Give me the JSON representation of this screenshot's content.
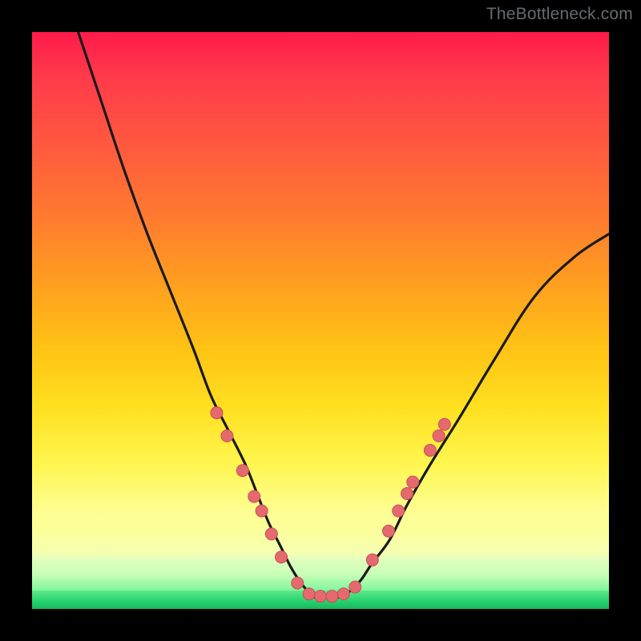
{
  "watermark": "TheBottleneck.com",
  "colors": {
    "frame": "#000000",
    "curve_stroke": "#1a1a1a",
    "dot_fill": "#e46a6f",
    "dot_stroke": "#c94f55",
    "gradient_top": "#ff1a4a",
    "gradient_bottom": "#16b85d"
  },
  "chart_data": {
    "type": "line",
    "title": "",
    "xlabel": "",
    "ylabel": "",
    "xlim": [
      0,
      100
    ],
    "ylim": [
      0,
      100
    ],
    "grid": false,
    "legend": false,
    "note": "Background is a vertical color gradient from red (top, high) through orange/yellow to green (bottom, low). The black curve is a V-shaped bottleneck profile with its minimum near x≈47–55 at y≈2. Salmon dots mark points along both flanks near the bottom of the V and a flat segment at the trough.",
    "series": [
      {
        "name": "bottleneck-curve",
        "x": [
          8,
          12,
          16,
          20,
          24,
          28,
          31,
          34,
          37,
          39,
          41,
          43,
          45,
          47,
          49,
          51,
          53,
          55,
          57,
          59,
          62,
          65,
          69,
          74,
          80,
          87,
          94,
          100
        ],
        "y": [
          100,
          88,
          76,
          65,
          55,
          45,
          37,
          31,
          25,
          20,
          15,
          11,
          7,
          4,
          2,
          2,
          2,
          3,
          5,
          8,
          12,
          18,
          25,
          33,
          43,
          54,
          61,
          65
        ]
      }
    ],
    "markers": [
      {
        "x": 32.0,
        "y": 34.0
      },
      {
        "x": 33.8,
        "y": 30.0
      },
      {
        "x": 36.5,
        "y": 24.0
      },
      {
        "x": 38.5,
        "y": 19.5
      },
      {
        "x": 39.8,
        "y": 17.0
      },
      {
        "x": 41.5,
        "y": 13.0
      },
      {
        "x": 43.2,
        "y": 9.0
      },
      {
        "x": 46.0,
        "y": 4.5
      },
      {
        "x": 48.0,
        "y": 2.6
      },
      {
        "x": 50.0,
        "y": 2.2
      },
      {
        "x": 52.0,
        "y": 2.2
      },
      {
        "x": 54.0,
        "y": 2.6
      },
      {
        "x": 56.0,
        "y": 3.8
      },
      {
        "x": 59.0,
        "y": 8.5
      },
      {
        "x": 61.8,
        "y": 13.5
      },
      {
        "x": 63.5,
        "y": 17.0
      },
      {
        "x": 65.0,
        "y": 20.0
      },
      {
        "x": 66.0,
        "y": 22.0
      },
      {
        "x": 69.0,
        "y": 27.5
      },
      {
        "x": 70.5,
        "y": 30.0
      },
      {
        "x": 71.5,
        "y": 32.0
      }
    ],
    "dot_radius_px": 7.5
  }
}
